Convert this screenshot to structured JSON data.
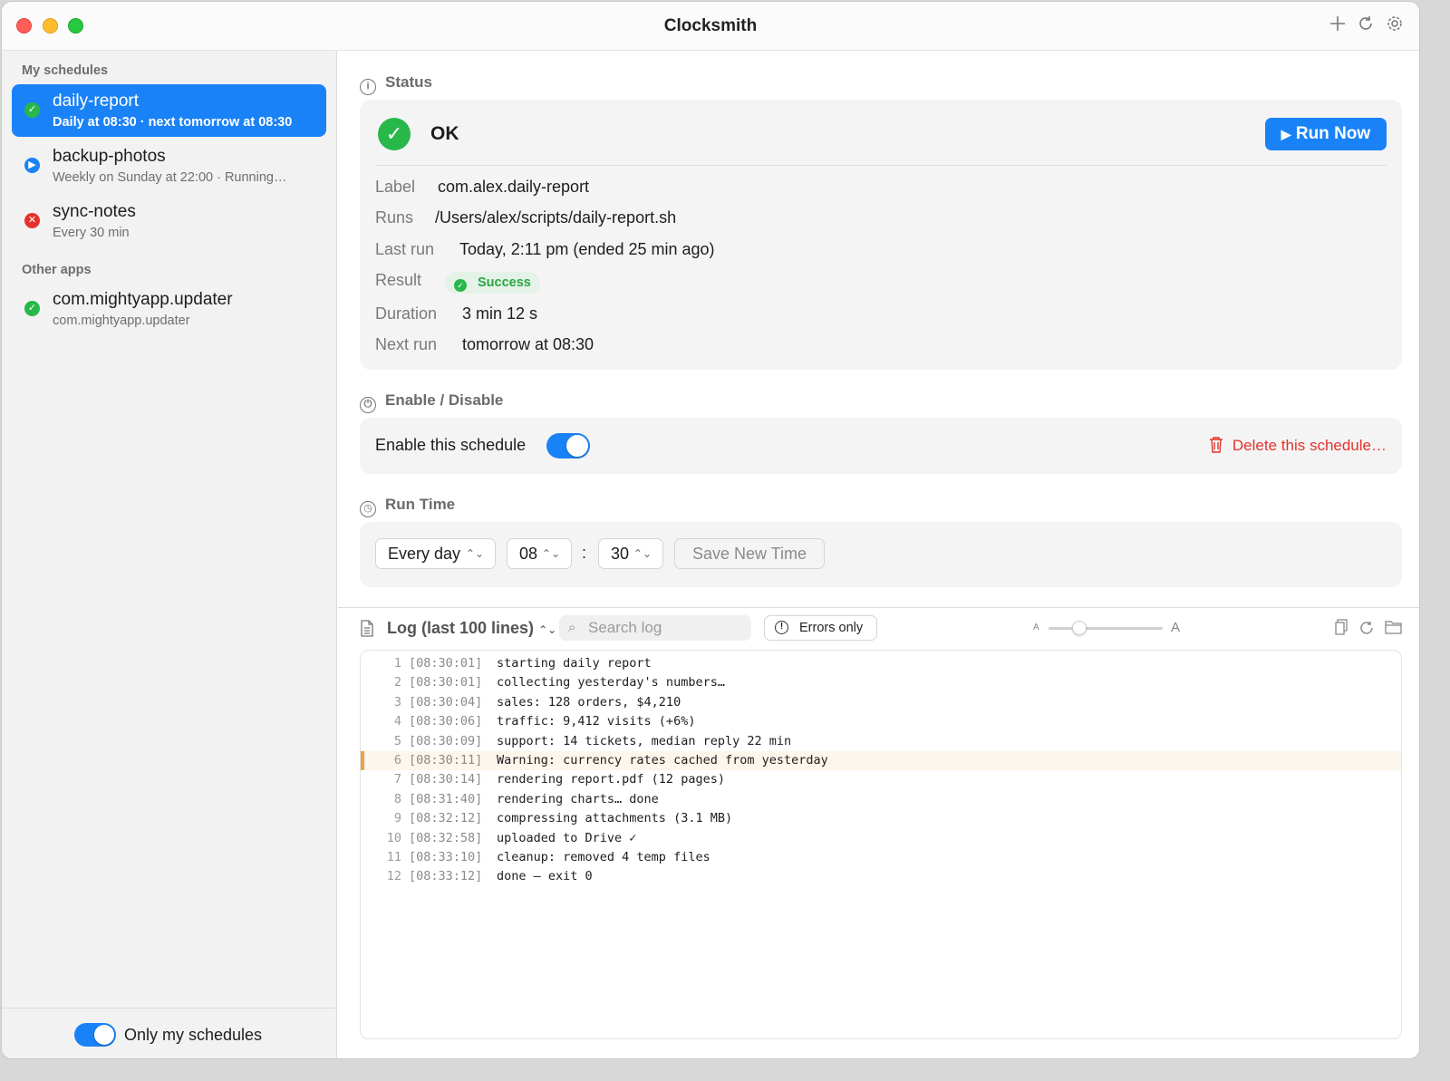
{
  "window": {
    "title": "Clocksmith"
  },
  "toolbar": {
    "add_icon": "plus-icon",
    "refresh_icon": "refresh-icon",
    "settings_icon": "gear-icon"
  },
  "sidebar": {
    "section_my": "My schedules",
    "items": [
      {
        "name": "daily-report",
        "sub": "Daily at 08:30 · next tomorrow at 08:30",
        "status": "success",
        "selected": true
      },
      {
        "name": "backup-photos",
        "sub": "Weekly on Sunday at 22:00 · Running…",
        "status": "running"
      },
      {
        "name": "sync-notes",
        "sub": "Every 30 min",
        "status": "error"
      }
    ],
    "section_other": "Other apps",
    "other_items": [
      {
        "name": "com.mightyapp.updater",
        "sub": "com.mightyapp.updater",
        "status": "success"
      }
    ],
    "footer_toggle_label": "Only my schedules",
    "footer_toggle_on": true
  },
  "status": {
    "heading": "Status",
    "state": "OK",
    "run_now": "Run Now",
    "fields": {
      "label_key": "Label",
      "label_val": "com.alex.daily-report",
      "runs_key": "Runs",
      "runs_val": "/Users/alex/scripts/daily-report.sh",
      "lastrun_key": "Last run",
      "lastrun_val": "Today, 2:11 pm (ended 25 min ago)",
      "result_key": "Result",
      "result_val": "Success",
      "duration_key": "Duration",
      "duration_val": "3 min 12 s",
      "nextrun_key": "Next run",
      "nextrun_val": "tomorrow at 08:30"
    }
  },
  "enable": {
    "heading": "Enable / Disable",
    "toggle_label": "Enable this schedule",
    "toggle_on": true,
    "delete_label": "Delete this schedule…"
  },
  "runtime": {
    "heading": "Run Time",
    "frequency": "Every day",
    "hour": "08",
    "separator": ":",
    "minute": "30",
    "save_label": "Save New Time"
  },
  "log": {
    "title": "Log (last 100 lines)",
    "search_placeholder": "Search log",
    "errors_only": "Errors only",
    "font_small": "A",
    "font_large": "A",
    "font_size_level": 0.27,
    "lines": [
      {
        "n": "1",
        "t": "[08:30:01]",
        "m": "starting daily report"
      },
      {
        "n": "2",
        "t": "[08:30:01]",
        "m": "collecting yesterday's numbers…"
      },
      {
        "n": "3",
        "t": "[08:30:04]",
        "m": "sales: 128 orders, $4,210"
      },
      {
        "n": "4",
        "t": "[08:30:06]",
        "m": "traffic: 9,412 visits (+6%)"
      },
      {
        "n": "5",
        "t": "[08:30:09]",
        "m": "support: 14 tickets, median reply 22 min"
      },
      {
        "n": "6",
        "t": "[08:30:11]",
        "m": "Warning: currency rates cached from yesterday",
        "warn": true
      },
      {
        "n": "7",
        "t": "[08:30:14]",
        "m": "rendering report.pdf (12 pages)"
      },
      {
        "n": "8",
        "t": "[08:31:40]",
        "m": "rendering charts… done"
      },
      {
        "n": "9",
        "t": "[08:32:12]",
        "m": "compressing attachments (3.1 MB)"
      },
      {
        "n": "10",
        "t": "[08:32:58]",
        "m": "uploaded to Drive ✓"
      },
      {
        "n": "11",
        "t": "[08:33:10]",
        "m": "cleanup: removed 4 temp files"
      },
      {
        "n": "12",
        "t": "[08:33:12]",
        "m": "done — exit 0"
      }
    ]
  },
  "colors": {
    "accent": "#1a82f7",
    "success": "#28b84a",
    "error": "#e5322b",
    "warning": "#f0a046"
  }
}
